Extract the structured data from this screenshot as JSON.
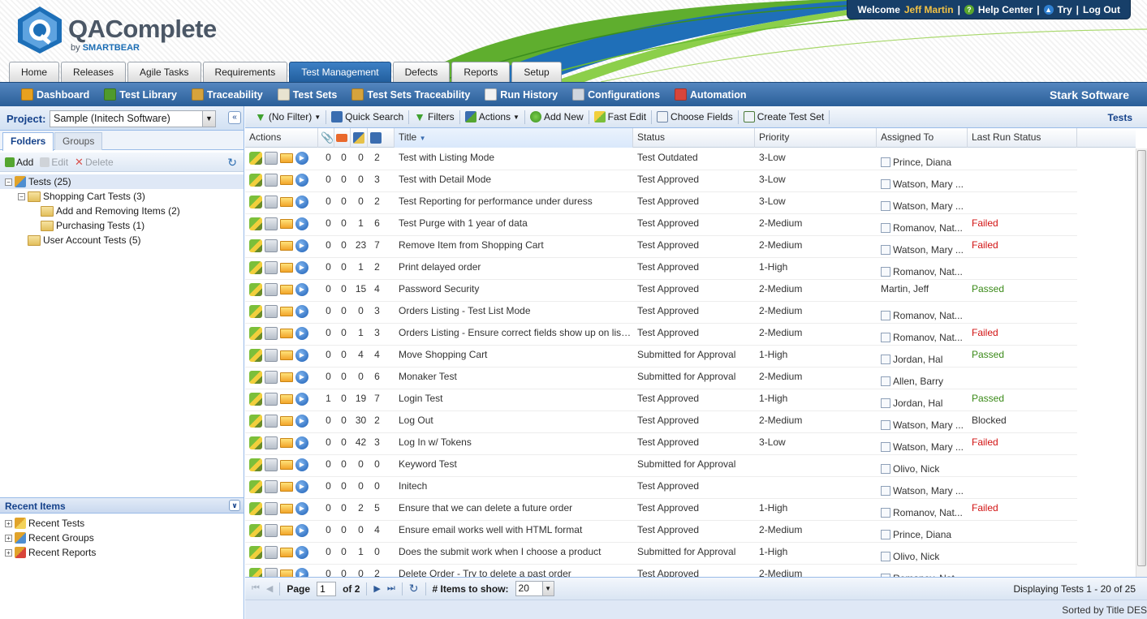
{
  "header": {
    "brand": "QAComplete",
    "brand_by": "by",
    "brand_maker": "SMARTBEAR",
    "welcome": "Welcome",
    "user_name": "Jeff Martin",
    "help_center": "Help Center",
    "try": "Try",
    "log_out": "Log Out"
  },
  "tabs": [
    {
      "label": "Home"
    },
    {
      "label": "Releases"
    },
    {
      "label": "Agile Tasks"
    },
    {
      "label": "Requirements"
    },
    {
      "label": "Test Management",
      "active": true
    },
    {
      "label": "Defects"
    },
    {
      "label": "Reports"
    },
    {
      "label": "Setup"
    }
  ],
  "subnav": {
    "items": [
      {
        "label": "Dashboard",
        "color": "#e8a11e"
      },
      {
        "label": "Test Library",
        "color": "#4f9a2c"
      },
      {
        "label": "Traceability",
        "color": "#d6a33c"
      },
      {
        "label": "Test Sets",
        "color": "#e8e3d0"
      },
      {
        "label": "Test Sets Traceability",
        "color": "#d6a33c"
      },
      {
        "label": "Run History",
        "color": "#f2f2f2"
      },
      {
        "label": "Configurations",
        "color": "#cfd6de"
      },
      {
        "label": "Automation",
        "color": "#d8453a"
      }
    ],
    "company": "Stark Software"
  },
  "left": {
    "project_label": "Project:",
    "project_value": "Sample (Initech Software)",
    "tab_folders": "Folders",
    "tab_groups": "Groups",
    "add": "Add",
    "edit": "Edit",
    "delete": "Delete",
    "tree": [
      {
        "label": "Tests (25)",
        "level": 0
      },
      {
        "label": "Shopping Cart Tests (3)",
        "level": 1
      },
      {
        "label": "Add and Removing Items (2)",
        "level": 2
      },
      {
        "label": "Purchasing Tests (1)",
        "level": 2
      },
      {
        "label": "User Account Tests (5)",
        "level": 1
      }
    ],
    "recent_title": "Recent Items",
    "recent": [
      {
        "label": "Recent Tests"
      },
      {
        "label": "Recent Groups"
      },
      {
        "label": "Recent Reports"
      }
    ]
  },
  "toolbar": {
    "no_filter": "(No Filter)",
    "quick_search": "Quick Search",
    "filters": "Filters",
    "actions": "Actions",
    "add_new": "Add New",
    "fast_edit": "Fast Edit",
    "choose_fields": "Choose Fields",
    "create_test_set": "Create Test Set",
    "grid_title": "Tests"
  },
  "columns": {
    "actions": "Actions",
    "title": "Title",
    "status": "Status",
    "priority": "Priority",
    "assigned_to": "Assigned To",
    "last_run_status": "Last Run Status"
  },
  "rows": [
    {
      "c1": "0",
      "c2": "0",
      "c3": "0",
      "c4": "2",
      "title": "Test with Listing Mode",
      "status": "Test Outdated",
      "priority": "3-Low",
      "assigned": "Prince, Diana",
      "last_run": ""
    },
    {
      "c1": "0",
      "c2": "0",
      "c3": "0",
      "c4": "3",
      "title": "Test with Detail Mode",
      "status": "Test Approved",
      "priority": "3-Low",
      "assigned": "Watson, Mary ...",
      "last_run": ""
    },
    {
      "c1": "0",
      "c2": "0",
      "c3": "0",
      "c4": "2",
      "title": "Test Reporting for performance under duress",
      "status": "Test Approved",
      "priority": "3-Low",
      "assigned": "Watson, Mary ...",
      "last_run": ""
    },
    {
      "c1": "0",
      "c2": "0",
      "c3": "1",
      "c4": "6",
      "title": "Test Purge with 1 year of data",
      "status": "Test Approved",
      "priority": "2-Medium",
      "assigned": "Romanov, Nat...",
      "last_run": "Failed"
    },
    {
      "c1": "0",
      "c2": "0",
      "c3": "23",
      "c4": "7",
      "title": "Remove Item from Shopping Cart",
      "status": "Test Approved",
      "priority": "2-Medium",
      "assigned": "Watson, Mary ...",
      "last_run": "Failed"
    },
    {
      "c1": "0",
      "c2": "0",
      "c3": "1",
      "c4": "2",
      "title": "Print delayed order",
      "status": "Test Approved",
      "priority": "1-High",
      "assigned": "Romanov, Nat...",
      "last_run": ""
    },
    {
      "c1": "0",
      "c2": "0",
      "c3": "15",
      "c4": "4",
      "title": "Password Security",
      "status": "Test Approved",
      "priority": "2-Medium",
      "assigned": "Martin, Jeff",
      "last_run": "Passed",
      "no_icon": true
    },
    {
      "c1": "0",
      "c2": "0",
      "c3": "0",
      "c4": "3",
      "title": "Orders Listing - Test List Mode",
      "status": "Test Approved",
      "priority": "2-Medium",
      "assigned": "Romanov, Nat...",
      "last_run": ""
    },
    {
      "c1": "0",
      "c2": "0",
      "c3": "1",
      "c4": "3",
      "title": "Orders Listing - Ensure correct fields show up on listing...",
      "status": "Test Approved",
      "priority": "2-Medium",
      "assigned": "Romanov, Nat...",
      "last_run": "Failed"
    },
    {
      "c1": "0",
      "c2": "0",
      "c3": "4",
      "c4": "4",
      "title": "Move Shopping Cart",
      "status": "Submitted for Approval",
      "priority": "1-High",
      "assigned": "Jordan, Hal",
      "last_run": "Passed"
    },
    {
      "c1": "0",
      "c2": "0",
      "c3": "0",
      "c4": "6",
      "title": "Monaker Test",
      "status": "Submitted for Approval",
      "priority": "2-Medium",
      "assigned": "Allen, Barry",
      "last_run": ""
    },
    {
      "c1": "1",
      "c2": "0",
      "c3": "19",
      "c4": "7",
      "title": "Login Test",
      "status": "Test Approved",
      "priority": "1-High",
      "assigned": "Jordan, Hal",
      "last_run": "Passed"
    },
    {
      "c1": "0",
      "c2": "0",
      "c3": "30",
      "c4": "2",
      "title": "Log Out",
      "status": "Test Approved",
      "priority": "2-Medium",
      "assigned": "Watson, Mary ...",
      "last_run": "Blocked"
    },
    {
      "c1": "0",
      "c2": "0",
      "c3": "42",
      "c4": "3",
      "title": "Log In w/ Tokens",
      "status": "Test Approved",
      "priority": "3-Low",
      "assigned": "Watson, Mary ...",
      "last_run": "Failed"
    },
    {
      "c1": "0",
      "c2": "0",
      "c3": "0",
      "c4": "0",
      "title": "Keyword Test",
      "status": "Submitted for Approval",
      "priority": "",
      "assigned": "Olivo, Nick",
      "last_run": ""
    },
    {
      "c1": "0",
      "c2": "0",
      "c3": "0",
      "c4": "0",
      "title": "Initech",
      "status": "Test Approved",
      "priority": "",
      "assigned": "Watson, Mary ...",
      "last_run": ""
    },
    {
      "c1": "0",
      "c2": "0",
      "c3": "2",
      "c4": "5",
      "title": "Ensure that we can delete a future order",
      "status": "Test Approved",
      "priority": "1-High",
      "assigned": "Romanov, Nat...",
      "last_run": "Failed"
    },
    {
      "c1": "0",
      "c2": "0",
      "c3": "0",
      "c4": "4",
      "title": "Ensure email works well with HTML format",
      "status": "Test Approved",
      "priority": "2-Medium",
      "assigned": "Prince, Diana",
      "last_run": ""
    },
    {
      "c1": "0",
      "c2": "0",
      "c3": "1",
      "c4": "0",
      "title": "Does the submit work when I choose a product",
      "status": "Submitted for Approval",
      "priority": "1-High",
      "assigned": "Olivo, Nick",
      "last_run": ""
    },
    {
      "c1": "0",
      "c2": "0",
      "c3": "0",
      "c4": "2",
      "title": "Delete Order - Try to delete a past order",
      "status": "Test Approved",
      "priority": "2-Medium",
      "assigned": "Romanov, Nat...",
      "last_run": ""
    }
  ],
  "pager": {
    "page_label": "Page",
    "page_value": "1",
    "of_label": "of 2",
    "items_label": "# Items to show:",
    "items_value": "20",
    "displaying": "Displaying Tests 1 - 20 of 25",
    "sorted_by": "Sorted by Title DES"
  },
  "colors": {
    "accent": "#2a5e98",
    "failed": "#d21313",
    "passed": "#3a8a18"
  }
}
